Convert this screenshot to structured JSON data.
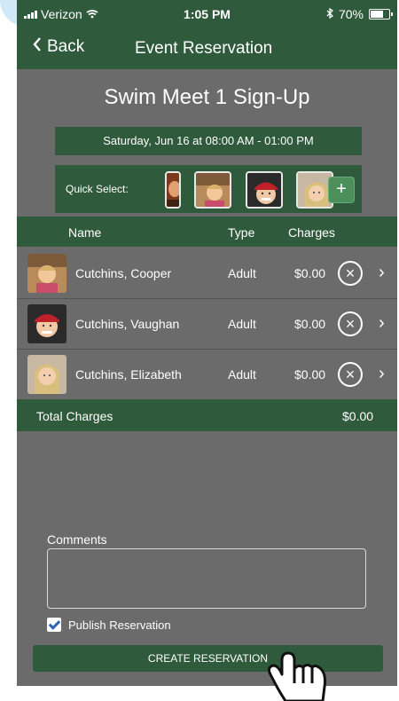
{
  "status": {
    "carrier": "Verizon",
    "time": "1:05 PM",
    "battery": "70%"
  },
  "nav": {
    "back_label": "Back",
    "title": "Event Reservation"
  },
  "event": {
    "title": "Swim Meet 1 Sign-Up",
    "datetime": "Saturday, Jun 16 at 08:00 AM - 01:00 PM"
  },
  "quick_select": {
    "label": "Quick Select:",
    "add_label": "+"
  },
  "table": {
    "headers": {
      "name": "Name",
      "type": "Type",
      "charges": "Charges"
    },
    "rows": [
      {
        "name": "Cutchins, Cooper",
        "type": "Adult",
        "charge": "$0.00"
      },
      {
        "name": "Cutchins, Vaughan",
        "type": "Adult",
        "charge": "$0.00"
      },
      {
        "name": "Cutchins, Elizabeth",
        "type": "Adult",
        "charge": "$0.00"
      }
    ]
  },
  "total": {
    "label": "Total Charges",
    "amount": "$0.00"
  },
  "comments": {
    "label": "Comments",
    "value": ""
  },
  "publish": {
    "label": "Publish Reservation",
    "checked": true
  },
  "create_button": {
    "label": "CREATE RESERVATION"
  }
}
